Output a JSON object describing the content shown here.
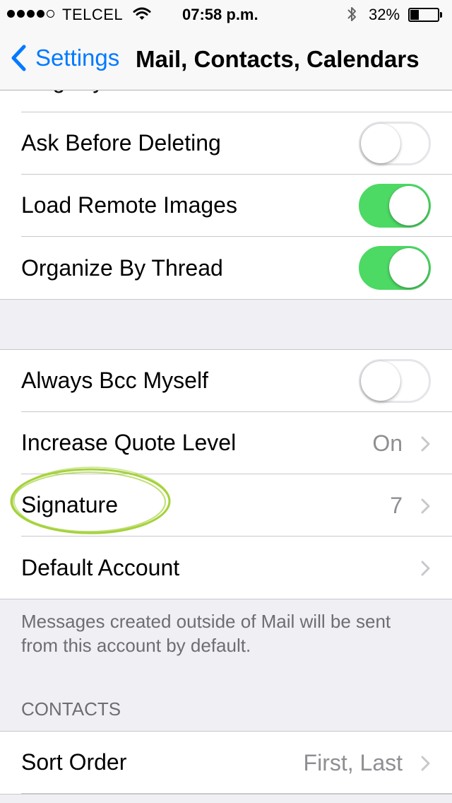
{
  "status_bar": {
    "carrier": "TELCEL",
    "time": "07:58 p.m.",
    "battery_percent": "32%",
    "battery_level": 0.32,
    "signal_bars_filled": 4,
    "signal_bars_total": 5,
    "icons": [
      "wifi-icon",
      "bluetooth-icon",
      "battery-icon"
    ]
  },
  "navbar": {
    "back_label": "Settings",
    "title": "Mail, Contacts, Calendars"
  },
  "mail_group_1": {
    "partial_item": "Flag Style",
    "items": [
      {
        "label": "Ask Before Deleting",
        "toggle": false
      },
      {
        "label": "Load Remote Images",
        "toggle": true
      },
      {
        "label": "Organize By Thread",
        "toggle": true
      }
    ]
  },
  "mail_group_2": {
    "always_bcc": {
      "label": "Always Bcc Myself",
      "toggle": false
    },
    "quote_level": {
      "label": "Increase Quote Level",
      "value": "On"
    },
    "signature": {
      "label": "Signature",
      "value": "7"
    },
    "default_account": {
      "label": "Default Account",
      "value": ""
    },
    "footer": "Messages created outside of Mail will be sent from this account by default."
  },
  "contacts_section": {
    "header": "CONTACTS",
    "sort_order": {
      "label": "Sort Order",
      "value": "First, Last"
    }
  },
  "colors": {
    "accent": "#007aff",
    "toggle_on": "#4cd964",
    "annotation": "#a5d23c",
    "background": "#efeff4"
  }
}
